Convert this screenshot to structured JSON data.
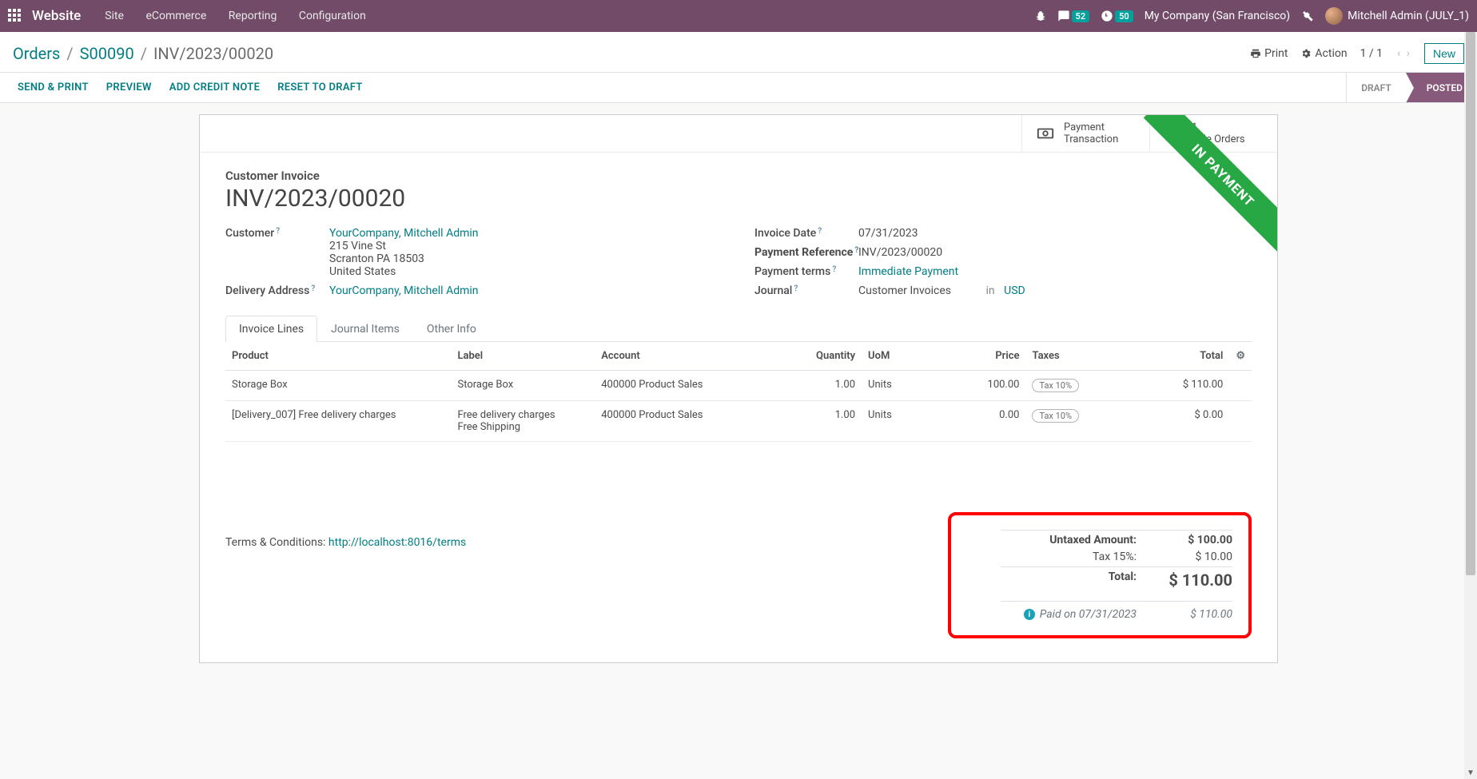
{
  "nav": {
    "brand": "Website",
    "menu": [
      "Site",
      "eCommerce",
      "Reporting",
      "Configuration"
    ],
    "messages_badge": "52",
    "activities_badge": "50",
    "company": "My Company (San Francisco)",
    "user": "Mitchell Admin (JULY_1)"
  },
  "breadcrumb": {
    "l1": "Orders",
    "l2": "S00090",
    "l3": "INV/2023/00020"
  },
  "toolbar": {
    "print": "Print",
    "action": "Action",
    "pager": "1 / 1",
    "new": "New"
  },
  "actions": {
    "send_print": "SEND & PRINT",
    "preview": "PREVIEW",
    "credit_note": "ADD CREDIT NOTE",
    "reset": "RESET TO DRAFT",
    "draft": "DRAFT",
    "posted": "POSTED"
  },
  "stat": {
    "payment_top": "Payment",
    "payment_bot": "Transaction",
    "sale_top": "1",
    "sale_bot": "Sale Orders"
  },
  "ribbon": "IN PAYMENT",
  "doc": {
    "subtitle": "Customer Invoice",
    "title": "INV/2023/00020"
  },
  "left": {
    "customer_lbl": "Customer",
    "customer_link": "YourCompany, Mitchell Admin",
    "addr1": "215 Vine St",
    "addr2": "Scranton PA 18503",
    "addr3": "United States",
    "delivery_lbl": "Delivery Address",
    "delivery_link": "YourCompany, Mitchell Admin"
  },
  "right": {
    "invdate_lbl": "Invoice Date",
    "invdate_val": "07/31/2023",
    "payref_lbl": "Payment Reference",
    "payref_val": "INV/2023/00020",
    "terms_lbl": "Payment terms",
    "terms_link": "Immediate Payment",
    "journal_lbl": "Journal",
    "journal_val": "Customer Invoices",
    "journal_in": "in",
    "journal_cur": "USD"
  },
  "tabs": {
    "t1": "Invoice Lines",
    "t2": "Journal Items",
    "t3": "Other Info"
  },
  "cols": {
    "product": "Product",
    "label": "Label",
    "account": "Account",
    "qty": "Quantity",
    "uom": "UoM",
    "price": "Price",
    "taxes": "Taxes",
    "total": "Total"
  },
  "rows": [
    {
      "product": "Storage Box",
      "label": "Storage Box",
      "account": "400000 Product Sales",
      "qty": "1.00",
      "uom": "Units",
      "price": "100.00",
      "tax": "Tax 10%",
      "total": "$ 110.00"
    },
    {
      "product": "[Delivery_007] Free delivery charges",
      "label": "Free delivery charges\nFree Shipping",
      "account": "400000 Product Sales",
      "qty": "1.00",
      "uom": "Units",
      "price": "0.00",
      "tax": "Tax 10%",
      "total": "$ 0.00"
    }
  ],
  "terms": {
    "lbl": "Terms & Conditions: ",
    "link": "http://localhost:8016/terms"
  },
  "totals": {
    "untaxed_lbl": "Untaxed Amount:",
    "untaxed_val": "$ 100.00",
    "tax_lbl": "Tax 15%:",
    "tax_val": "$ 10.00",
    "total_lbl": "Total:",
    "total_val": "$ 110.00",
    "paid_lbl": "Paid on 07/31/2023",
    "paid_val": "$ 110.00"
  }
}
